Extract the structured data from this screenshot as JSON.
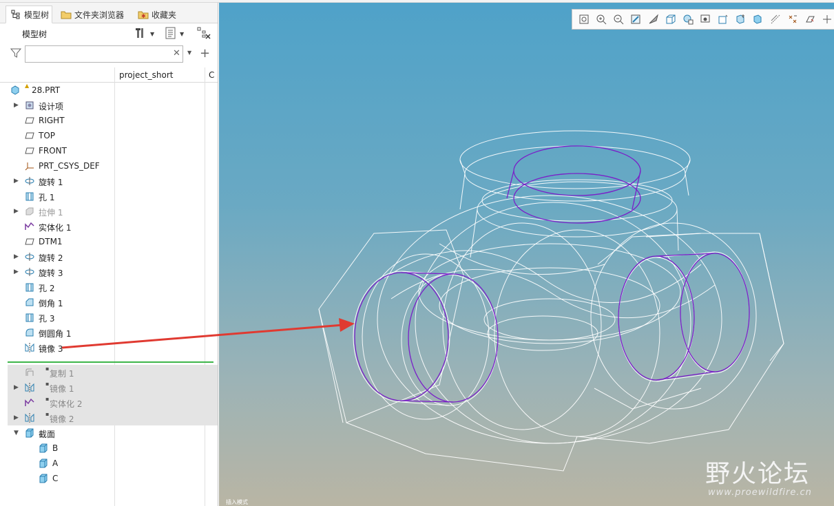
{
  "tabs": [
    {
      "label": "模型树",
      "icon": "tree-icon"
    },
    {
      "label": "文件夹浏览器",
      "icon": "folder-icon"
    },
    {
      "label": "收藏夹",
      "icon": "star-folder-icon"
    }
  ],
  "tree_panel": {
    "title": "模型树",
    "search": {
      "value": "",
      "placeholder": ""
    },
    "columns": [
      "project_short",
      "C"
    ]
  },
  "tree_items": [
    {
      "label": "28.PRT",
      "icon": "part-icon",
      "warn": "▲"
    },
    {
      "label": "设计项",
      "icon": "design-item-icon"
    },
    {
      "label": "RIGHT",
      "icon": "datum-plane-icon"
    },
    {
      "label": "TOP",
      "icon": "datum-plane-icon"
    },
    {
      "label": "FRONT",
      "icon": "datum-plane-icon"
    },
    {
      "label": "PRT_CSYS_DEF",
      "icon": "csys-icon"
    },
    {
      "label": "旋转 1",
      "icon": "revolve-icon"
    },
    {
      "label": "孔 1",
      "icon": "hole-icon"
    },
    {
      "label": "拉伸 1",
      "icon": "extrude-icon"
    },
    {
      "label": "实体化 1",
      "icon": "solidify-icon"
    },
    {
      "label": "DTM1",
      "icon": "datum-plane-icon"
    },
    {
      "label": "旋转 2",
      "icon": "revolve-icon"
    },
    {
      "label": "旋转 3",
      "icon": "revolve-icon"
    },
    {
      "label": "孔 2",
      "icon": "hole-icon"
    },
    {
      "label": "倒角 1",
      "icon": "chamfer-icon"
    },
    {
      "label": "孔 3",
      "icon": "hole-icon"
    },
    {
      "label": "倒圆角 1",
      "icon": "round-icon"
    },
    {
      "label": "镜像 3",
      "icon": "mirror-icon"
    },
    {
      "label": "复制 1",
      "icon": "copy-icon"
    },
    {
      "label": "镜像 1",
      "icon": "mirror-icon"
    },
    {
      "label": "实体化 2",
      "icon": "solidify-icon"
    },
    {
      "label": "镜像 2",
      "icon": "mirror-icon"
    },
    {
      "label": "截面",
      "icon": "section-icon"
    },
    {
      "label": "B",
      "icon": "section-icon"
    },
    {
      "label": "A",
      "icon": "section-icon"
    },
    {
      "label": "C",
      "icon": "section-icon"
    }
  ],
  "suppressed_mark": "▪",
  "viewport": {
    "status_text": "插入模式",
    "watermark_text": "野火论坛",
    "watermark_url": "www.proewildfire.cn",
    "toolbar": [
      "refit-icon",
      "zoom-in-icon",
      "zoom-out-icon",
      "repaint-icon",
      "display-style-icon",
      "saved-views-icon",
      "view-manager-icon",
      "perspective-icon",
      "named-view-icon",
      "plane-display-icon",
      "axis-display-icon",
      "point-display-icon",
      "csys-display-icon",
      "annotation-display-icon",
      "spin-center-icon"
    ]
  },
  "colors": {
    "accent_arrow": "#e03a31",
    "insert_line": "#3db54a",
    "highlight_edge": "#7a1fc8"
  }
}
